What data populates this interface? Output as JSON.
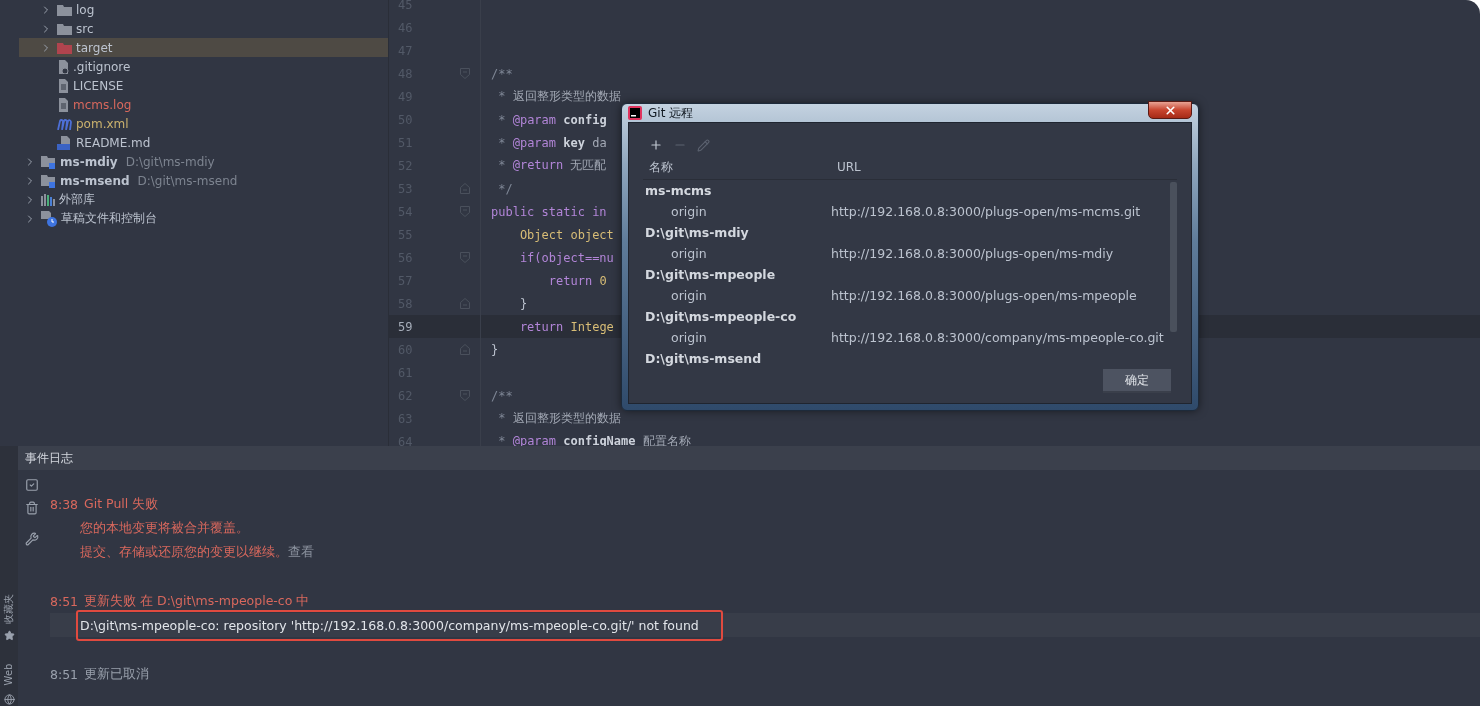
{
  "project_tree": [
    {
      "children": [
        {
          "label": "log",
          "kind": "folder",
          "expandable": true,
          "selected": false,
          "color": "#bcc3cf"
        },
        {
          "label": "src",
          "kind": "folder",
          "expandable": true,
          "selected": false,
          "color": "#bcc3cf"
        },
        {
          "label": "target",
          "kind": "excluded-folder",
          "expandable": true,
          "selected": true,
          "color": "#bcc3cf"
        },
        {
          "label": ".gitignore",
          "kind": "ignore-file",
          "expandable": false,
          "selected": false,
          "color": "#bcc3cf"
        },
        {
          "label": "LICENSE",
          "kind": "text-file",
          "expandable": false,
          "selected": false,
          "color": "#bcc3cf"
        },
        {
          "label": "mcms.log",
          "kind": "text-file",
          "expandable": false,
          "selected": false,
          "color": "#d9685d"
        },
        {
          "label": "pom.xml",
          "kind": "maven-file",
          "expandable": false,
          "selected": false,
          "color": "#cbb26e"
        },
        {
          "label": "README.md",
          "kind": "markdown-file",
          "expandable": false,
          "selected": false,
          "color": "#bcc3cf"
        }
      ]
    },
    {
      "label": "ms-mdiy",
      "path": "D:\\git\\ms-mdiy",
      "kind": "module",
      "expandable": true,
      "selected": false,
      "color": "#bcc3cf"
    },
    {
      "label": "ms-msend",
      "path": "D:\\git\\ms-msend",
      "kind": "module",
      "expandable": true,
      "selected": false,
      "color": "#bcc3cf"
    },
    {
      "label": "外部库",
      "kind": "library",
      "expandable": true,
      "selected": false,
      "color": "#bcc3cf"
    },
    {
      "label": "草稿文件和控制台",
      "kind": "scratch",
      "expandable": true,
      "selected": false,
      "color": "#bcc3cf"
    }
  ],
  "editor": {
    "lines": [
      {
        "number": "45",
        "current": false
      },
      {
        "number": "46",
        "current": false
      },
      {
        "number": "47",
        "current": false
      },
      {
        "number": "48",
        "current": false,
        "kind": "fold-start",
        "segments": [
          {
            "t": "/**",
            "kind": "comment"
          }
        ]
      },
      {
        "number": "49",
        "current": false,
        "segments": [
          {
            "t": " * ",
            "kind": "comment"
          },
          {
            "t": "返回整形类型的数据",
            "kind": "doc"
          }
        ]
      },
      {
        "number": "50",
        "current": false,
        "segments": [
          {
            "t": " * ",
            "kind": "comment"
          },
          {
            "t": "@param",
            "kind": "tag"
          },
          {
            "t": " config",
            "kind": "param"
          }
        ]
      },
      {
        "number": "51",
        "current": false,
        "segments": [
          {
            "t": " * ",
            "kind": "comment"
          },
          {
            "t": "@param",
            "kind": "tag"
          },
          {
            "t": " key",
            "kind": "param"
          },
          {
            "t": " da",
            "kind": "doc"
          }
        ]
      },
      {
        "number": "52",
        "current": false,
        "segments": [
          {
            "t": " * ",
            "kind": "comment"
          },
          {
            "t": "@return",
            "kind": "tag"
          },
          {
            "t": " 无匹配",
            "kind": "doc"
          }
        ]
      },
      {
        "number": "53",
        "current": false,
        "kind": "fold-end",
        "segments": [
          {
            "t": " */",
            "kind": "comment"
          }
        ]
      },
      {
        "number": "54",
        "current": false,
        "kind": "fold-start",
        "segments": [
          {
            "t": "public static in",
            "kind": "keyword"
          }
        ]
      },
      {
        "number": "55",
        "current": false,
        "segments": [
          {
            "t": "    Object object",
            "kind": "type"
          }
        ]
      },
      {
        "number": "56",
        "current": false,
        "kind": "fold-start",
        "segments": [
          {
            "t": "    if(object==nu",
            "kind": "keyword"
          }
        ]
      },
      {
        "number": "57",
        "current": false,
        "segments": [
          {
            "t": "        return ",
            "kind": "keyword"
          },
          {
            "t": "0",
            "kind": "number"
          }
        ]
      },
      {
        "number": "58",
        "current": false,
        "kind": "fold-end",
        "segments": [
          {
            "t": "    }",
            "kind": "plain"
          }
        ]
      },
      {
        "number": "59",
        "current": true,
        "segments": [
          {
            "t": "    return ",
            "kind": "keyword"
          },
          {
            "t": "Intege",
            "kind": "type"
          }
        ]
      },
      {
        "number": "60",
        "current": false,
        "kind": "fold-end",
        "segments": [
          {
            "t": "}",
            "kind": "plain"
          }
        ]
      },
      {
        "number": "61",
        "current": false
      },
      {
        "number": "62",
        "current": false,
        "kind": "fold-start",
        "segments": [
          {
            "t": "/**",
            "kind": "comment"
          }
        ]
      },
      {
        "number": "63",
        "current": false,
        "segments": [
          {
            "t": " * ",
            "kind": "comment"
          },
          {
            "t": "返回整形类型的数据",
            "kind": "doc"
          }
        ]
      },
      {
        "number": "64",
        "current": false,
        "segments": [
          {
            "t": " * ",
            "kind": "comment"
          },
          {
            "t": "@param",
            "kind": "tag"
          },
          {
            "t": " configName",
            "kind": "param"
          },
          {
            "t": " 配置名称",
            "kind": "doc"
          }
        ]
      }
    ]
  },
  "dialog": {
    "title": "Git 远程",
    "toolbar": [
      {
        "kind": "add",
        "disabled": false
      },
      {
        "kind": "remove",
        "disabled": true
      },
      {
        "kind": "edit",
        "disabled": true
      }
    ],
    "columns": [
      "名称",
      "URL"
    ],
    "groups": [
      {
        "name": "ms-mcms",
        "remotes": [
          {
            "name": "origin",
            "url": "http://192.168.0.8:3000/plugs-open/ms-mcms.git"
          }
        ]
      },
      {
        "name": "D:\\git\\ms-mdiy",
        "remotes": [
          {
            "name": "origin",
            "url": "http://192.168.0.8:3000/plugs-open/ms-mdiy"
          }
        ]
      },
      {
        "name": "D:\\git\\ms-mpeople",
        "remotes": [
          {
            "name": "origin",
            "url": "http://192.168.0.8:3000/plugs-open/ms-mpeople"
          }
        ]
      },
      {
        "name": "D:\\git\\ms-mpeople-co",
        "remotes": [
          {
            "name": "origin",
            "url": "http://192.168.0.8:3000/company/ms-mpeople-co.git"
          }
        ]
      },
      {
        "name": "D:\\git\\ms-msend"
      }
    ],
    "ok_button": "确定"
  },
  "event_log": {
    "title": "事件日志",
    "entries": [
      {
        "time": "8:38",
        "title": "Git Pull 失败",
        "kind": "error",
        "lines": [
          {
            "text": "您的本地变更将被合并覆盖。",
            "kind": "error",
            "highlighted": false,
            "annotated": false
          },
          {
            "text": "提交、存储或还原您的变更以继续。",
            "link": "查看",
            "kind": "error",
            "highlighted": false,
            "annotated": false
          }
        ]
      },
      {
        "time": "8:51",
        "title": "更新失败 在 D:\\git\\ms-mpeople-co 中",
        "kind": "error",
        "lines": [
          {
            "text": "D:\\git\\ms-mpeople-co: repository 'http://192.168.0.8:3000/company/ms-mpeople-co.git/' not found",
            "kind": "plain",
            "highlighted": true,
            "annotated": true
          }
        ]
      },
      {
        "time": "8:51",
        "title": "更新已取消",
        "kind": "info"
      }
    ]
  },
  "side_tabs": [
    {
      "label": "收藏夹",
      "kind": "favorites"
    },
    {
      "label": "Web",
      "kind": "web"
    }
  ]
}
